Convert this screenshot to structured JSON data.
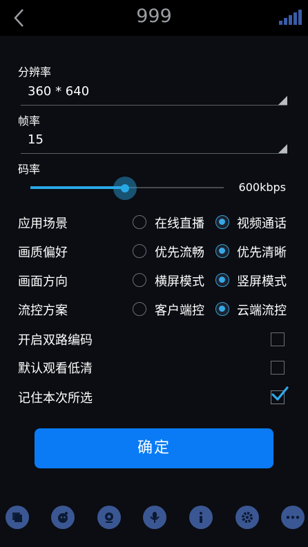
{
  "header": {
    "title": "999",
    "back_icon": "chevron-left-icon",
    "signal_icon": "signal-bars-icon"
  },
  "resolution": {
    "label": "分辨率",
    "value": "360 * 640"
  },
  "framerate": {
    "label": "帧率",
    "value": "15"
  },
  "bitrate": {
    "label": "码率",
    "value": "600kbps",
    "slider_fraction": 0.49
  },
  "options": [
    {
      "label": "应用场景",
      "choices": [
        "在线直播",
        "视频通话"
      ],
      "selected": 1
    },
    {
      "label": "画质偏好",
      "choices": [
        "优先流畅",
        "优先清晰"
      ],
      "selected": 1
    },
    {
      "label": "画面方向",
      "choices": [
        "横屏模式",
        "竖屏模式"
      ],
      "selected": 1
    },
    {
      "label": "流控方案",
      "choices": [
        "客户端控",
        "云端流控"
      ],
      "selected": 1
    }
  ],
  "checks": [
    {
      "label": "开启双路编码",
      "checked": false
    },
    {
      "label": "默认观看低清",
      "checked": false
    },
    {
      "label": "记住本次所选",
      "checked": true
    }
  ],
  "confirm_label": "确定",
  "toolbar_icons": [
    "screen-icon",
    "beauty-icon",
    "camera-icon",
    "mic-icon",
    "info-icon",
    "settings-icon",
    "more-icon"
  ],
  "colors": {
    "accent": "#29a8e6",
    "button": "#0a7bf4",
    "toolbar_icon_bg": "#3b5793"
  }
}
